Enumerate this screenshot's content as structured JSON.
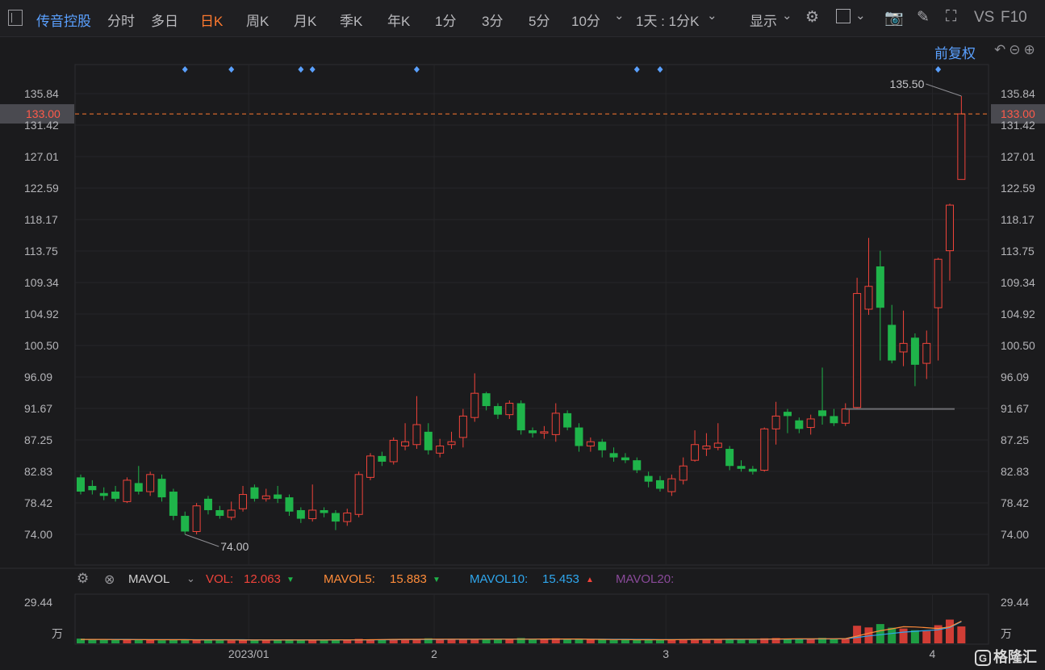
{
  "toolbar": {
    "stock_name": "传音控股",
    "tabs": [
      {
        "label": "分时",
        "active": false
      },
      {
        "label": "多日",
        "active": false
      },
      {
        "label": "日K",
        "active": true
      },
      {
        "label": "周K",
        "active": false
      },
      {
        "label": "月K",
        "active": false
      },
      {
        "label": "季K",
        "active": false
      },
      {
        "label": "年K",
        "active": false
      },
      {
        "label": "1分",
        "active": false
      },
      {
        "label": "3分",
        "active": false
      },
      {
        "label": "5分",
        "active": false
      },
      {
        "label": "10分",
        "active": false
      }
    ],
    "period_select": "1天 : 1分K",
    "display_label": "显示",
    "vs_label": "VS",
    "f10_label": "F10"
  },
  "price_panel": {
    "fuquan_label": "前复权",
    "y_ticks": [
      "135.84",
      "131.42",
      "127.01",
      "122.59",
      "118.17",
      "113.75",
      "109.34",
      "104.92",
      "100.50",
      "96.09",
      "91.67",
      "87.25",
      "82.83",
      "78.42",
      "74.00"
    ],
    "current_price_label": "133.00",
    "max_label": "135.50",
    "min_label": "74.00"
  },
  "volume_panel": {
    "indicator": "MAVOL",
    "vol_label": "VOL:",
    "vol_value": "12.063",
    "mavol5_label": "MAVOL5:",
    "mavol5_value": "15.883",
    "mavol10_label": "MAVOL10:",
    "mavol10_value": "15.453",
    "mavol20_label": "MAVOL20:",
    "y_top": "29.44",
    "y_unit": "万"
  },
  "x_labels": [
    "2023/01",
    "2",
    "3",
    "4"
  ],
  "logo": "格隆汇",
  "colors": {
    "up": "#f0433a",
    "down": "#1fb44a",
    "accent": "#ff7a2f",
    "blue": "#5aa0ff",
    "mavol5": "#ff8c3a",
    "mavol10": "#2fa7ee",
    "mavol20": "#b05fc6"
  },
  "chart_data": {
    "type": "candlestick",
    "price_axis": {
      "min": 74.0,
      "max": 135.84
    },
    "reference_price": 133.0,
    "candles": [
      {
        "o": 82.0,
        "c": 80.0,
        "h": 82.4,
        "l": 79.6
      },
      {
        "o": 80.8,
        "c": 80.2,
        "h": 81.6,
        "l": 79.6
      },
      {
        "o": 79.8,
        "c": 79.4,
        "h": 80.6,
        "l": 78.8
      },
      {
        "o": 80.0,
        "c": 79.0,
        "h": 80.8,
        "l": 78.6
      },
      {
        "o": 78.6,
        "c": 81.6,
        "h": 82.0,
        "l": 78.4
      },
      {
        "o": 81.2,
        "c": 80.0,
        "h": 83.6,
        "l": 79.6
      },
      {
        "o": 80.0,
        "c": 82.4,
        "h": 82.8,
        "l": 79.4
      },
      {
        "o": 81.8,
        "c": 79.2,
        "h": 82.4,
        "l": 78.6
      },
      {
        "o": 80.0,
        "c": 76.6,
        "h": 80.4,
        "l": 76.0
      },
      {
        "o": 76.6,
        "c": 74.4,
        "h": 77.2,
        "l": 74.0
      },
      {
        "o": 74.4,
        "c": 78.0,
        "h": 78.4,
        "l": 74.0
      },
      {
        "o": 79.0,
        "c": 77.4,
        "h": 79.4,
        "l": 76.8
      },
      {
        "o": 77.4,
        "c": 76.6,
        "h": 78.0,
        "l": 76.2
      },
      {
        "o": 76.4,
        "c": 77.4,
        "h": 78.6,
        "l": 76.0
      },
      {
        "o": 77.6,
        "c": 79.6,
        "h": 80.8,
        "l": 77.2
      },
      {
        "o": 80.6,
        "c": 79.0,
        "h": 81.0,
        "l": 78.6
      },
      {
        "o": 79.0,
        "c": 79.4,
        "h": 80.4,
        "l": 78.6
      },
      {
        "o": 79.6,
        "c": 79.0,
        "h": 80.8,
        "l": 78.4
      },
      {
        "o": 79.2,
        "c": 77.2,
        "h": 79.6,
        "l": 76.6
      },
      {
        "o": 77.4,
        "c": 76.2,
        "h": 77.8,
        "l": 75.6
      },
      {
        "o": 76.2,
        "c": 77.4,
        "h": 81.0,
        "l": 75.8
      },
      {
        "o": 77.4,
        "c": 77.0,
        "h": 77.8,
        "l": 76.4
      },
      {
        "o": 77.0,
        "c": 75.8,
        "h": 77.4,
        "l": 74.6
      },
      {
        "o": 75.8,
        "c": 77.0,
        "h": 77.6,
        "l": 75.2
      },
      {
        "o": 76.8,
        "c": 82.4,
        "h": 82.8,
        "l": 76.4
      },
      {
        "o": 82.0,
        "c": 85.0,
        "h": 85.4,
        "l": 81.6
      },
      {
        "o": 85.0,
        "c": 84.2,
        "h": 85.6,
        "l": 83.6
      },
      {
        "o": 84.2,
        "c": 87.2,
        "h": 87.6,
        "l": 83.8
      },
      {
        "o": 86.4,
        "c": 87.0,
        "h": 89.6,
        "l": 85.8
      },
      {
        "o": 86.6,
        "c": 89.4,
        "h": 93.4,
        "l": 86.0
      },
      {
        "o": 88.4,
        "c": 85.8,
        "h": 89.6,
        "l": 85.2
      },
      {
        "o": 85.4,
        "c": 86.4,
        "h": 87.4,
        "l": 84.8
      },
      {
        "o": 86.6,
        "c": 87.0,
        "h": 88.4,
        "l": 86.0
      },
      {
        "o": 87.6,
        "c": 90.6,
        "h": 91.6,
        "l": 86.2
      },
      {
        "o": 90.4,
        "c": 93.8,
        "h": 96.6,
        "l": 89.8
      },
      {
        "o": 93.8,
        "c": 92.0,
        "h": 94.0,
        "l": 91.4
      },
      {
        "o": 92.0,
        "c": 90.8,
        "h": 92.4,
        "l": 90.2
      },
      {
        "o": 90.8,
        "c": 92.4,
        "h": 92.8,
        "l": 90.2
      },
      {
        "o": 92.4,
        "c": 88.6,
        "h": 92.8,
        "l": 88.0
      },
      {
        "o": 88.6,
        "c": 88.2,
        "h": 89.0,
        "l": 87.6
      },
      {
        "o": 88.2,
        "c": 88.4,
        "h": 89.2,
        "l": 87.4
      },
      {
        "o": 88.0,
        "c": 91.0,
        "h": 92.4,
        "l": 87.0
      },
      {
        "o": 91.0,
        "c": 89.0,
        "h": 91.4,
        "l": 88.6
      },
      {
        "o": 89.0,
        "c": 86.4,
        "h": 89.6,
        "l": 85.6
      },
      {
        "o": 86.4,
        "c": 87.0,
        "h": 87.6,
        "l": 85.6
      },
      {
        "o": 87.0,
        "c": 85.8,
        "h": 87.4,
        "l": 84.8
      },
      {
        "o": 85.4,
        "c": 84.8,
        "h": 86.2,
        "l": 84.2
      },
      {
        "o": 84.8,
        "c": 84.4,
        "h": 85.4,
        "l": 84.0
      },
      {
        "o": 84.4,
        "c": 83.0,
        "h": 84.8,
        "l": 82.6
      },
      {
        "o": 82.2,
        "c": 81.4,
        "h": 82.8,
        "l": 80.6
      },
      {
        "o": 81.6,
        "c": 80.4,
        "h": 82.2,
        "l": 80.0
      },
      {
        "o": 80.0,
        "c": 81.8,
        "h": 82.4,
        "l": 79.4
      },
      {
        "o": 81.6,
        "c": 83.6,
        "h": 84.8,
        "l": 81.0
      },
      {
        "o": 84.4,
        "c": 86.6,
        "h": 88.6,
        "l": 84.2
      },
      {
        "o": 86.0,
        "c": 86.4,
        "h": 88.2,
        "l": 85.0
      },
      {
        "o": 86.2,
        "c": 86.8,
        "h": 89.6,
        "l": 85.8
      },
      {
        "o": 86.0,
        "c": 83.6,
        "h": 86.4,
        "l": 83.0
      },
      {
        "o": 83.6,
        "c": 83.2,
        "h": 84.4,
        "l": 82.8
      },
      {
        "o": 83.2,
        "c": 82.8,
        "h": 83.6,
        "l": 82.4
      },
      {
        "o": 83.0,
        "c": 88.8,
        "h": 89.0,
        "l": 82.8
      },
      {
        "o": 88.8,
        "c": 90.6,
        "h": 92.6,
        "l": 86.6
      },
      {
        "o": 91.2,
        "c": 90.6,
        "h": 91.6,
        "l": 88.2
      },
      {
        "o": 90.0,
        "c": 88.8,
        "h": 90.4,
        "l": 88.2
      },
      {
        "o": 89.0,
        "c": 90.2,
        "h": 90.8,
        "l": 88.0
      },
      {
        "o": 91.4,
        "c": 90.6,
        "h": 97.4,
        "l": 89.4
      },
      {
        "o": 90.6,
        "c": 89.6,
        "h": 91.6,
        "l": 89.2
      },
      {
        "o": 89.6,
        "c": 91.6,
        "h": 92.4,
        "l": 89.2
      },
      {
        "o": 91.8,
        "c": 107.8,
        "h": 110.0,
        "l": 91.6
      },
      {
        "o": 105.6,
        "c": 108.8,
        "h": 115.6,
        "l": 104.8
      },
      {
        "o": 111.6,
        "c": 105.8,
        "h": 113.8,
        "l": 98.4
      },
      {
        "o": 103.4,
        "c": 98.4,
        "h": 106.2,
        "l": 98.0
      },
      {
        "o": 99.6,
        "c": 100.8,
        "h": 105.4,
        "l": 97.6
      },
      {
        "o": 101.6,
        "c": 97.8,
        "h": 102.2,
        "l": 94.8
      },
      {
        "o": 98.0,
        "c": 100.8,
        "h": 102.6,
        "l": 95.8
      },
      {
        "o": 105.8,
        "c": 112.6,
        "h": 112.8,
        "l": 98.4
      },
      {
        "o": 113.8,
        "c": 120.2,
        "h": 120.4,
        "l": 109.6
      },
      {
        "o": 123.8,
        "c": 133.0,
        "h": 135.5,
        "l": 123.8
      }
    ],
    "volume_axis": {
      "max": 29.44,
      "unit": "万"
    },
    "volumes": [
      3.4,
      2.6,
      2.5,
      2.4,
      3.0,
      2.4,
      2.9,
      2.2,
      2.5,
      2.3,
      2.8,
      2.3,
      2.2,
      2.1,
      2.4,
      2.3,
      2.2,
      2.3,
      2.8,
      2.6,
      2.7,
      2.1,
      2.3,
      2.4,
      3.2,
      2.9,
      2.7,
      3.0,
      2.8,
      3.2,
      3.6,
      2.6,
      3.0,
      3.2,
      3.0,
      3.2,
      2.8,
      3.0,
      3.8,
      2.8,
      2.9,
      3.6,
      2.7,
      2.8,
      2.6,
      2.7,
      2.4,
      2.6,
      2.9,
      2.7,
      2.5,
      2.6,
      3.0,
      3.2,
      2.9,
      3.1,
      3.2,
      2.8,
      2.9,
      3.6,
      3.8,
      3.0,
      2.9,
      3.1,
      3.9,
      3.0,
      3.3,
      12.6,
      11.4,
      13.8,
      11.2,
      10.6,
      9.4,
      8.8,
      13.0,
      17.0,
      12.1
    ],
    "mavol5": [
      2.8,
      2.8,
      2.8,
      2.7,
      2.7,
      2.7,
      2.6,
      2.6,
      2.6,
      2.6,
      2.5,
      2.5,
      2.5,
      2.5,
      2.4,
      2.4,
      2.4,
      2.4,
      2.4,
      2.4,
      2.4,
      2.4,
      2.5,
      2.5,
      2.5,
      2.6,
      2.7,
      2.8,
      2.9,
      2.9,
      3.0,
      3.0,
      3.0,
      3.0,
      3.0,
      3.0,
      3.0,
      3.0,
      3.0,
      3.0,
      3.1,
      3.1,
      3.1,
      3.1,
      2.9,
      2.8,
      2.7,
      2.7,
      2.6,
      2.6,
      2.6,
      2.6,
      2.7,
      2.8,
      2.9,
      2.9,
      3.0,
      3.0,
      3.0,
      3.0,
      3.1,
      3.2,
      3.3,
      3.3,
      3.3,
      3.3,
      3.4,
      5.2,
      7.3,
      9.0,
      10.4,
      11.9,
      11.7,
      11.2,
      10.6,
      11.8,
      15.9
    ],
    "mavol10": [
      2.8,
      2.8,
      2.8,
      2.8,
      2.8,
      2.7,
      2.7,
      2.7,
      2.7,
      2.7,
      2.6,
      2.6,
      2.6,
      2.6,
      2.6,
      2.5,
      2.5,
      2.5,
      2.5,
      2.5,
      2.5,
      2.5,
      2.5,
      2.5,
      2.5,
      2.5,
      2.6,
      2.6,
      2.7,
      2.7,
      2.8,
      2.8,
      2.9,
      2.9,
      2.9,
      3.0,
      3.0,
      3.0,
      3.0,
      3.0,
      3.0,
      3.0,
      3.0,
      3.0,
      3.0,
      3.0,
      2.9,
      2.9,
      2.8,
      2.8,
      2.7,
      2.7,
      2.7,
      2.7,
      2.8,
      2.8,
      2.8,
      2.8,
      2.9,
      2.9,
      3.0,
      3.0,
      3.1,
      3.1,
      3.2,
      3.2,
      3.3,
      4.3,
      5.3,
      6.2,
      7.1,
      8.0,
      8.6,
      9.2,
      9.7,
      11.4,
      15.5
    ],
    "dividend_markers_candle_index": [
      9,
      13,
      19,
      20,
      29,
      48,
      50,
      74
    ]
  }
}
